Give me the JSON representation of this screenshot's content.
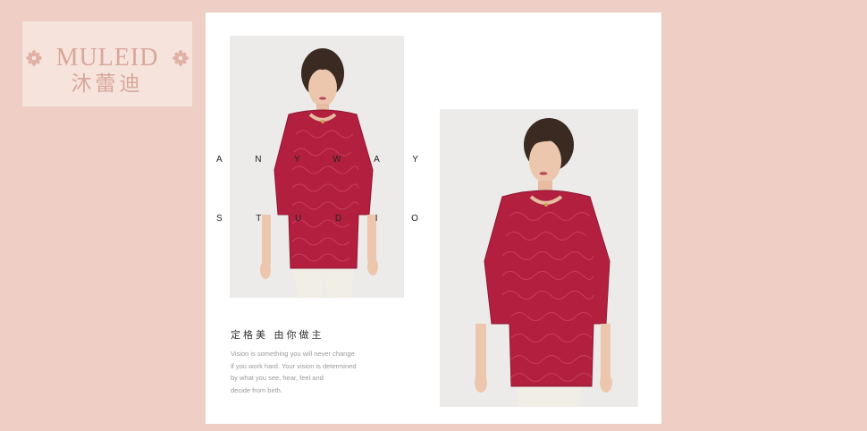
{
  "brand": {
    "name_en": "MULEID",
    "name_cn": "沐蕾迪"
  },
  "promo": {
    "tagline_letters_1": [
      "A",
      "N",
      "Y",
      "W",
      "A",
      "Y"
    ],
    "tagline_letters_2": [
      "S",
      "T",
      "U",
      "D",
      "I",
      "O"
    ],
    "slogan_cn": "定格美 由你做主",
    "description_lines": [
      "Vision is something you will never change",
      "if you work hard. Your vision is determined",
      "by what you see, hear, feel and",
      "decide from birth."
    ]
  },
  "product": {
    "photo_1": "model-front-view",
    "photo_2": "model-three-quarter-view",
    "garment_color": "#b3203f"
  },
  "colors": {
    "background": "#efcfc5",
    "logo_box": "#f6e3dc",
    "logo_text": "#d8a69a"
  }
}
